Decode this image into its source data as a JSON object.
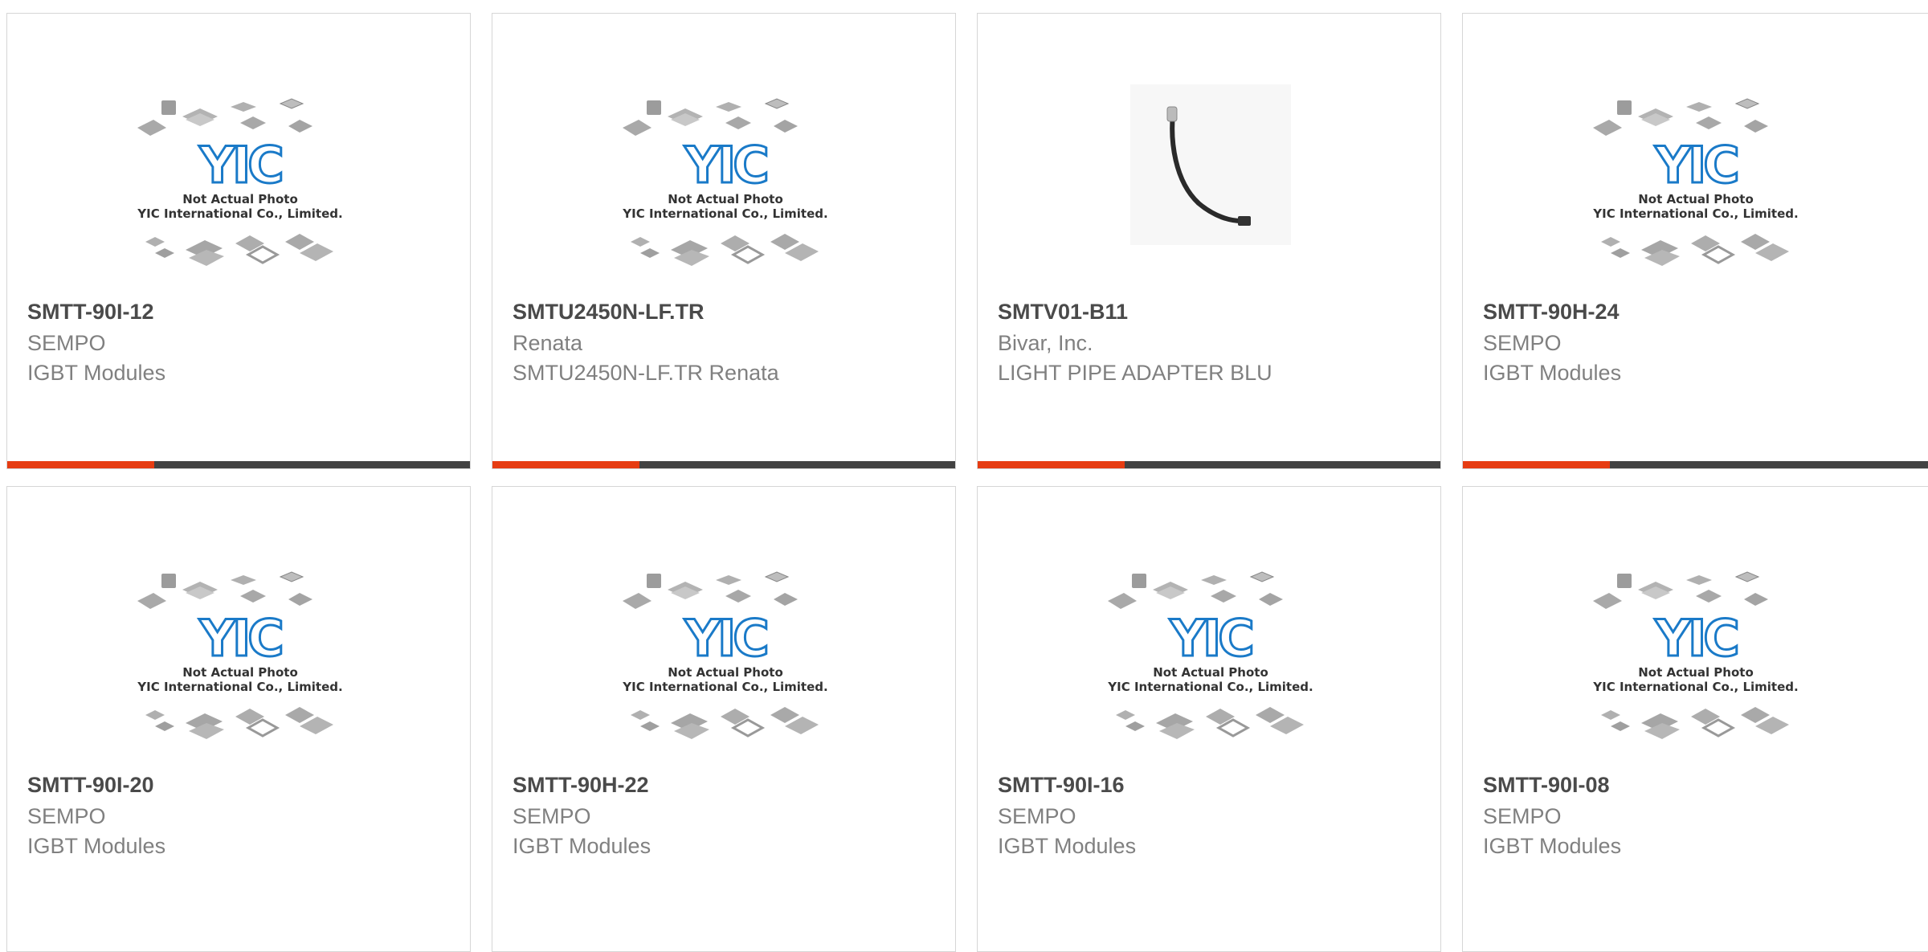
{
  "colors": {
    "accent": "#e63c12",
    "bar": "#424242",
    "logo": "#1a7ac8"
  },
  "placeholder": {
    "line1": "Not Actual Photo",
    "line2": "YIC International Co., Limited.",
    "logo": "YIC"
  },
  "products": [
    {
      "part": "SMTT-90I-12",
      "maker": "SEMPO",
      "desc": "IGBT Modules",
      "image": "placeholder"
    },
    {
      "part": "SMTU2450N-LF.TR",
      "maker": "Renata",
      "desc": "SMTU2450N-LF.TR Renata",
      "image": "placeholder"
    },
    {
      "part": "SMTV01-B11",
      "maker": "Bivar, Inc.",
      "desc": "LIGHT PIPE ADAPTER BLU",
      "image": "light-pipe-cable"
    },
    {
      "part": "SMTT-90H-24",
      "maker": "SEMPO",
      "desc": "IGBT Modules",
      "image": "placeholder"
    },
    {
      "part": "SMTT-90I-20",
      "maker": "SEMPO",
      "desc": "IGBT Modules",
      "image": "placeholder"
    },
    {
      "part": "SMTT-90H-22",
      "maker": "SEMPO",
      "desc": "IGBT Modules",
      "image": "placeholder"
    },
    {
      "part": "SMTT-90I-16",
      "maker": "SEMPO",
      "desc": "IGBT Modules",
      "image": "placeholder"
    },
    {
      "part": "SMTT-90I-08",
      "maker": "SEMPO",
      "desc": "IGBT Modules",
      "image": "placeholder"
    }
  ]
}
